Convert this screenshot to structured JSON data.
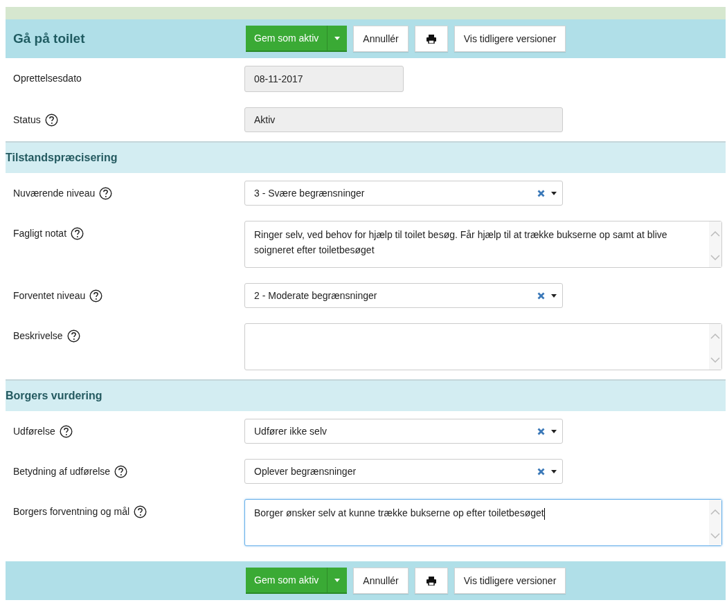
{
  "title": "Gå på toilet",
  "toolbar": [
    {
      "kind": "save",
      "label": "Gem som aktiv"
    },
    {
      "kind": "cancel",
      "label": "Annullér"
    },
    {
      "kind": "print"
    },
    {
      "kind": "versions",
      "label": "Vis tidligere versioner"
    }
  ],
  "fields": [
    {
      "label": "Oprettelsesdato",
      "help": false,
      "kind": "date",
      "value": "08-11-2017"
    },
    {
      "label": "Status",
      "help": true,
      "kind": "readonly",
      "value": "Aktiv"
    }
  ],
  "sections": [
    {
      "title": "Tilstandspræcisering",
      "fields": [
        {
          "label": "Nuværende niveau",
          "help": true,
          "kind": "select",
          "value": "3 - Svære begrænsninger"
        },
        {
          "label": "Fagligt notat",
          "help": true,
          "kind": "textarea",
          "focused": false,
          "value": "Ringer selv, ved behov for hjælp til toilet besøg. Får hjælp til at trække bukserne op samt at blive soigneret efter toiletbesøget"
        },
        {
          "label": "Forventet niveau",
          "help": true,
          "kind": "select",
          "value": "2 - Moderate begrænsninger"
        },
        {
          "label": "Beskrivelse",
          "help": true,
          "kind": "textarea",
          "focused": false
        }
      ]
    },
    {
      "title": "Borgers vurdering",
      "fields": [
        {
          "label": "Udførelse",
          "help": true,
          "kind": "select",
          "value": "Udfører ikke selv"
        },
        {
          "label": "Betydning af udførelse",
          "help": true,
          "kind": "select",
          "value": "Oplever begrænsninger"
        },
        {
          "label": "Borgers forventning og mål",
          "help": true,
          "kind": "textarea",
          "focused": true,
          "value": "Borger ønsker selv at kunne trække bukserne op efter toiletbesøget"
        }
      ]
    }
  ],
  "footer_toolbar": [
    {
      "kind": "save",
      "label": "Gem som aktiv"
    },
    {
      "kind": "cancel",
      "label": "Annullér"
    },
    {
      "kind": "print"
    },
    {
      "kind": "versions",
      "label": "Vis tidligere versioner"
    }
  ]
}
